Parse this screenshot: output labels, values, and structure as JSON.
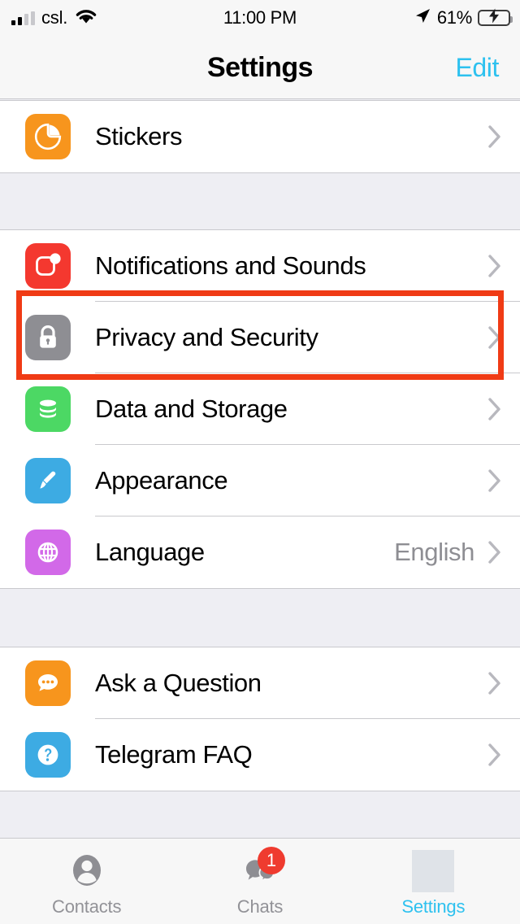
{
  "status_bar": {
    "carrier": "csl.",
    "signal_bars_filled": 2,
    "signal_bars_total": 4,
    "wifi_icon": "wifi-icon",
    "time": "11:00 PM",
    "location_icon": "location-arrow-icon",
    "battery_percent": "61%",
    "battery_level": 61,
    "battery_charging": true
  },
  "nav": {
    "title": "Settings",
    "edit_label": "Edit",
    "accent_color": "#2dc1ef"
  },
  "groups": [
    {
      "name": "stickers-group",
      "rows": [
        {
          "name": "stickers",
          "label": "Stickers",
          "icon": "sticker-icon",
          "icon_color": "#f7951d",
          "value": "",
          "chevron": true
        }
      ]
    },
    {
      "name": "preferences-group",
      "rows": [
        {
          "name": "notifications-and-sounds",
          "label": "Notifications and Sounds",
          "icon": "notification-icon",
          "icon_color": "#f4382f",
          "value": "",
          "chevron": true
        },
        {
          "name": "privacy-and-security",
          "label": "Privacy and Security",
          "icon": "lock-icon",
          "icon_color": "#8e8e93",
          "value": "",
          "chevron": true
        },
        {
          "name": "data-and-storage",
          "label": "Data and Storage",
          "icon": "database-icon",
          "icon_color": "#4cd864",
          "value": "",
          "chevron": true
        },
        {
          "name": "appearance",
          "label": "Appearance",
          "icon": "paintbrush-icon",
          "icon_color": "#3dabe3",
          "value": "",
          "chevron": true
        },
        {
          "name": "language",
          "label": "Language",
          "icon": "globe-icon",
          "icon_color": "#d269e8",
          "value": "English",
          "chevron": true
        }
      ]
    },
    {
      "name": "help-group",
      "rows": [
        {
          "name": "ask-a-question",
          "label": "Ask a Question",
          "icon": "chat-bubble-icon",
          "icon_color": "#f7951d",
          "value": "",
          "chevron": true
        },
        {
          "name": "telegram-faq",
          "label": "Telegram FAQ",
          "icon": "question-mark-icon",
          "icon_color": "#3dabe3",
          "value": "",
          "chevron": true
        }
      ]
    }
  ],
  "highlight": {
    "target": "privacy-and-security",
    "color": "#f03b15"
  },
  "tabs": [
    {
      "name": "tab-contacts",
      "label": "Contacts",
      "icon": "person-icon",
      "active": false,
      "badge": ""
    },
    {
      "name": "tab-chats",
      "label": "Chats",
      "icon": "chats-icon",
      "active": false,
      "badge": "1"
    },
    {
      "name": "tab-settings",
      "label": "Settings",
      "icon": "settings-placeholder-icon",
      "active": true,
      "badge": ""
    }
  ]
}
